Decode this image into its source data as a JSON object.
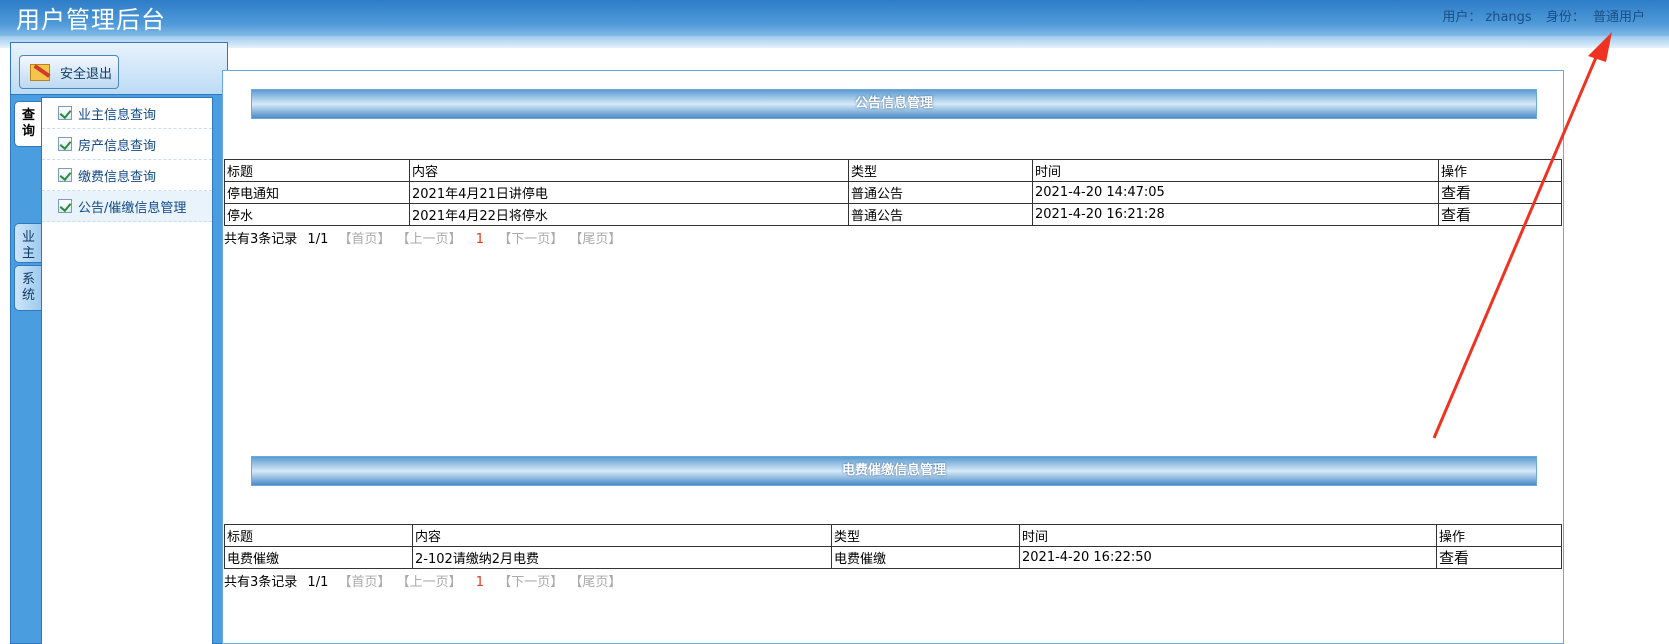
{
  "header": {
    "title": "用户管理后台",
    "user_label": "用户：",
    "user_name": "zhangs",
    "role_label": "身份：",
    "role_value": "普通用户"
  },
  "sidebar": {
    "logout_label": "安全退出",
    "tabs": [
      {
        "label": "查\n询",
        "active": true
      },
      {
        "label": "业\n主",
        "active": false
      },
      {
        "label": "系\n统",
        "active": false
      }
    ],
    "items": [
      {
        "label": "业主信息查询"
      },
      {
        "label": "房产信息查询"
      },
      {
        "label": "缴费信息查询"
      },
      {
        "label": "公告/催缴信息管理"
      }
    ]
  },
  "announcements": {
    "heading": "公告信息管理",
    "columns": [
      "标题",
      "内容",
      "类型",
      "时间",
      "操作"
    ],
    "rows": [
      [
        "停电通知",
        "2021年4月21日讲停电",
        "普通公告",
        "2021-4-20 14:47:05",
        "查看"
      ],
      [
        "停水",
        "2021年4月22日将停水",
        "普通公告",
        "2021-4-20 16:21:28",
        "查看"
      ]
    ],
    "pager": {
      "total": "共有3条记录",
      "pages": "1/1",
      "first": "【首页】",
      "prev": "【上一页】",
      "current": "1",
      "next": "【下一页】",
      "last": "【尾页】"
    }
  },
  "fee_reminders": {
    "heading": "电费催缴信息管理",
    "columns": [
      "标题",
      "内容",
      "类型",
      "时间",
      "操作"
    ],
    "rows": [
      [
        "电费催缴",
        "2-102请缴纳2月电费",
        "电费催缴",
        "2021-4-20 16:22:50",
        "查看"
      ]
    ],
    "pager": {
      "total": "共有3条记录",
      "pages": "1/1",
      "first": "【首页】",
      "prev": "【上一页】",
      "current": "1",
      "next": "【下一页】",
      "last": "【尾页】"
    }
  },
  "colors": {
    "header_blue": "#2d7dc7",
    "panel_blue": "#4a9ee0",
    "annotation_red": "#ee3322",
    "pager_current": "#e23a1a"
  }
}
